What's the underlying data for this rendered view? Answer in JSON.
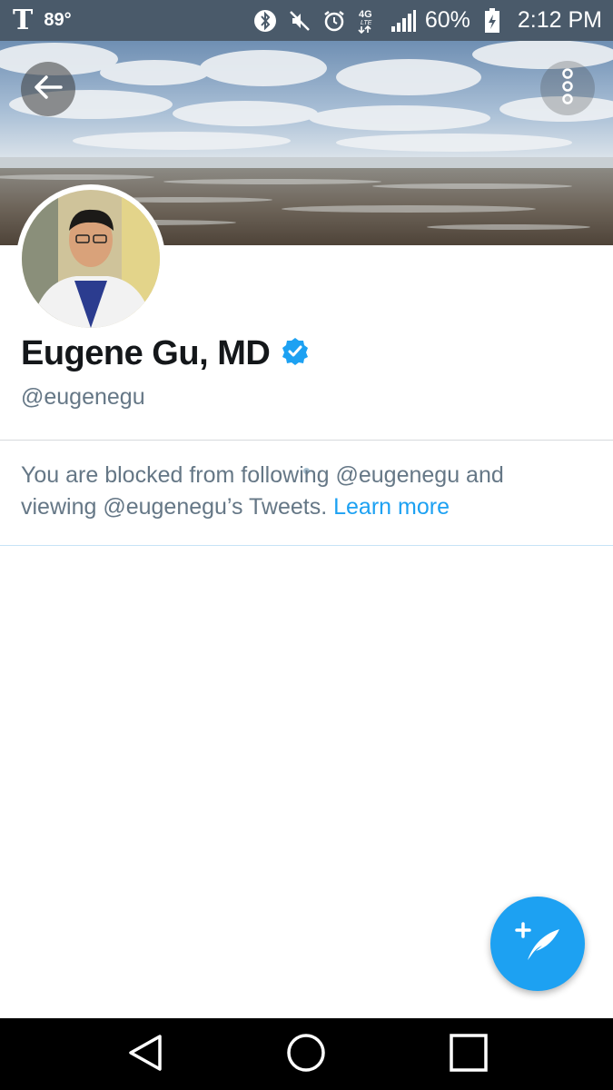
{
  "status_bar": {
    "carrier_logo": "T",
    "temperature": "89°",
    "battery": "60%",
    "time": "2:12 PM",
    "network_label": "4G LTE",
    "icons": [
      "bluetooth-icon",
      "mute-icon",
      "alarm-icon",
      "network-4g-icon",
      "signal-icon",
      "battery-charging-icon"
    ]
  },
  "header": {
    "back_icon": "arrow-left-icon",
    "more_icon": "more-vertical-icon"
  },
  "profile": {
    "display_name": "Eugene Gu, MD",
    "verified": true,
    "handle": "@eugenegu"
  },
  "blocked_notice": {
    "message": "You are blocked from following @eugenegu and viewing @eugenegu’s Tweets.",
    "learn_more": "Learn more"
  },
  "fab": {
    "icon": "compose-tweet-icon",
    "plus": "+"
  },
  "navbar": {
    "icons": [
      "nav-back-icon",
      "nav-home-icon",
      "nav-recent-apps-icon"
    ]
  },
  "colors": {
    "accent": "#1da1f2",
    "status_bar": "#4a5a6a",
    "text_primary": "#14171a",
    "text_secondary": "#657786"
  }
}
